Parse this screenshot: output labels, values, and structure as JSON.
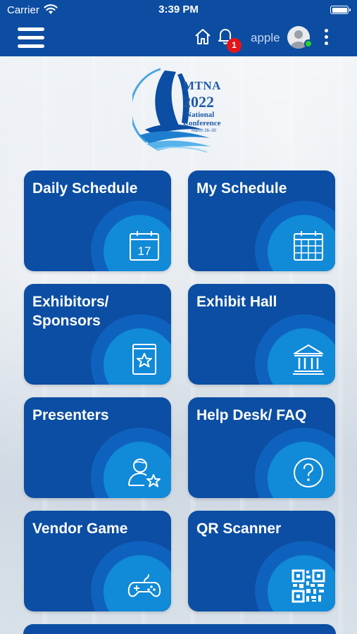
{
  "status_bar": {
    "carrier": "Carrier",
    "time": "3:39 PM"
  },
  "app_bar": {
    "notification_count": "1",
    "username": "apple"
  },
  "logo": {
    "title": "MTNA",
    "year": "2022",
    "subtitle_1": "National",
    "subtitle_2": "Conference",
    "dates": "March 26–30"
  },
  "tiles": [
    {
      "label": "Daily Schedule",
      "icon": "calendar-17-icon"
    },
    {
      "label": "My Schedule",
      "icon": "calendar-grid-icon"
    },
    {
      "label": "Exhibitors/ Sponsors",
      "icon": "star-book-icon"
    },
    {
      "label": "Exhibit Hall",
      "icon": "building-icon"
    },
    {
      "label": "Presenters",
      "icon": "person-star-icon"
    },
    {
      "label": "Help Desk/ FAQ",
      "icon": "question-icon"
    },
    {
      "label": "Vendor Game",
      "icon": "gamepad-icon"
    },
    {
      "label": "QR Scanner",
      "icon": "qr-code-icon"
    }
  ],
  "colors": {
    "brand_blue": "#0c4da2",
    "tile_blue": "#0b4ea3",
    "accent_blue": "#118ad8",
    "badge_red": "#e5141b",
    "online_green": "#2ed12e"
  }
}
